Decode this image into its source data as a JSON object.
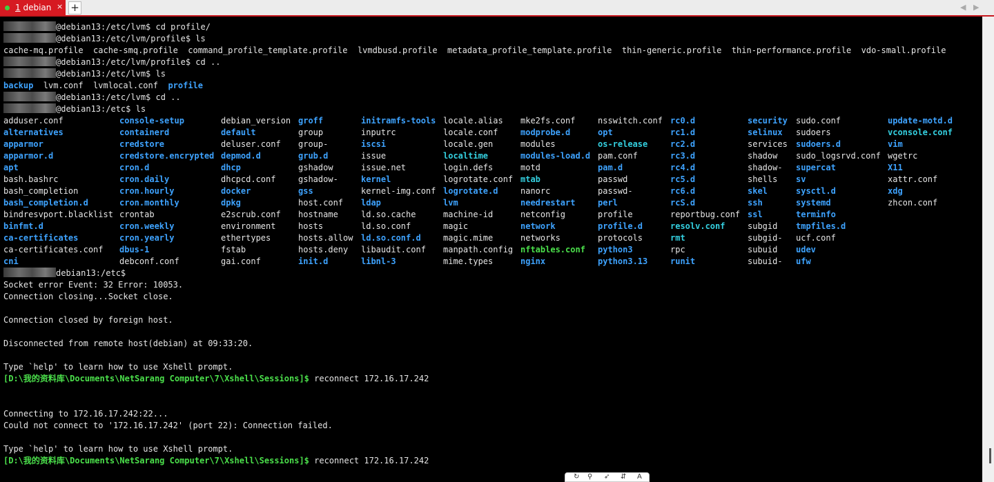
{
  "tab": {
    "number": "1",
    "title": "debian",
    "close_glyph": "×",
    "new_tab_glyph": "+",
    "status_color": "#3fd13f"
  },
  "nav": {
    "prev_glyph": "◀",
    "next_glyph": "▶"
  },
  "terminal": {
    "lines_before": [
      {
        "mask": true,
        "text": "@debian13:/etc/lvm$ cd profile/"
      },
      {
        "mask": true,
        "text": "@debian13:/etc/lvm/profile$ ls"
      },
      {
        "mask": false,
        "text": "cache-mq.profile  cache-smq.profile  command_profile_template.profile  lvmdbusd.profile  metadata_profile_template.profile  thin-generic.profile  thin-performance.profile  vdo-small.profile"
      },
      {
        "mask": true,
        "text": "@debian13:/etc/lvm/profile$ cd .."
      },
      {
        "mask": true,
        "text": "@debian13:/etc/lvm$ ls"
      },
      {
        "mask": false,
        "segments": [
          {
            "text": "backup",
            "cls": "dir"
          },
          {
            "text": "  lvm.conf  lvmlocal.conf  ",
            "cls": ""
          },
          {
            "text": "profile",
            "cls": "dir"
          }
        ]
      },
      {
        "mask": true,
        "text": "@debian13:/etc/lvm$ cd .."
      },
      {
        "mask": true,
        "text": "@debian13:/etc$ ls"
      }
    ],
    "ls_columns": [
      [
        [
          "adduser.conf",
          ""
        ],
        [
          "alternatives",
          "dir"
        ],
        [
          "apparmor",
          "dir"
        ],
        [
          "apparmor.d",
          "dir"
        ],
        [
          "apt",
          "dir"
        ],
        [
          "bash.bashrc",
          ""
        ],
        [
          "bash_completion",
          ""
        ],
        [
          "bash_completion.d",
          "dir"
        ],
        [
          "bindresvport.blacklist",
          ""
        ],
        [
          "binfmt.d",
          "dir"
        ],
        [
          "ca-certificates",
          "dir"
        ],
        [
          "ca-certificates.conf",
          ""
        ],
        [
          "cni",
          "dir"
        ]
      ],
      [
        [
          "console-setup",
          "dir"
        ],
        [
          "containerd",
          "dir"
        ],
        [
          "credstore",
          "dir"
        ],
        [
          "credstore.encrypted",
          "dir"
        ],
        [
          "cron.d",
          "dir"
        ],
        [
          "cron.daily",
          "dir"
        ],
        [
          "cron.hourly",
          "dir"
        ],
        [
          "cron.monthly",
          "dir"
        ],
        [
          "crontab",
          ""
        ],
        [
          "cron.weekly",
          "dir"
        ],
        [
          "cron.yearly",
          "dir"
        ],
        [
          "dbus-1",
          "dir"
        ],
        [
          "debconf.conf",
          ""
        ]
      ],
      [
        [
          "debian_version",
          ""
        ],
        [
          "default",
          "dir"
        ],
        [
          "deluser.conf",
          ""
        ],
        [
          "depmod.d",
          "dir"
        ],
        [
          "dhcp",
          "dir"
        ],
        [
          "dhcpcd.conf",
          ""
        ],
        [
          "docker",
          "dir"
        ],
        [
          "dpkg",
          "dir"
        ],
        [
          "e2scrub.conf",
          ""
        ],
        [
          "environment",
          ""
        ],
        [
          "ethertypes",
          ""
        ],
        [
          "fstab",
          ""
        ],
        [
          "gai.conf",
          ""
        ]
      ],
      [
        [
          "groff",
          "dir"
        ],
        [
          "group",
          ""
        ],
        [
          "group-",
          ""
        ],
        [
          "grub.d",
          "dir"
        ],
        [
          "gshadow",
          ""
        ],
        [
          "gshadow-",
          ""
        ],
        [
          "gss",
          "dir"
        ],
        [
          "host.conf",
          ""
        ],
        [
          "hostname",
          ""
        ],
        [
          "hosts",
          ""
        ],
        [
          "hosts.allow",
          ""
        ],
        [
          "hosts.deny",
          ""
        ],
        [
          "init.d",
          "dir"
        ]
      ],
      [
        [
          "initramfs-tools",
          "dir"
        ],
        [
          "inputrc",
          ""
        ],
        [
          "iscsi",
          "dir"
        ],
        [
          "issue",
          ""
        ],
        [
          "issue.net",
          ""
        ],
        [
          "kernel",
          "dir"
        ],
        [
          "kernel-img.conf",
          ""
        ],
        [
          "ldap",
          "dir"
        ],
        [
          "ld.so.cache",
          ""
        ],
        [
          "ld.so.conf",
          ""
        ],
        [
          "ld.so.conf.d",
          "dir"
        ],
        [
          "libaudit.conf",
          ""
        ],
        [
          "libnl-3",
          "dir"
        ]
      ],
      [
        [
          "locale.alias",
          ""
        ],
        [
          "locale.conf",
          ""
        ],
        [
          "locale.gen",
          ""
        ],
        [
          "localtime",
          "link"
        ],
        [
          "login.defs",
          ""
        ],
        [
          "logrotate.conf",
          ""
        ],
        [
          "logrotate.d",
          "dir"
        ],
        [
          "lvm",
          "dir"
        ],
        [
          "machine-id",
          ""
        ],
        [
          "magic",
          ""
        ],
        [
          "magic.mime",
          ""
        ],
        [
          "manpath.config",
          ""
        ],
        [
          "mime.types",
          ""
        ]
      ],
      [
        [
          "mke2fs.conf",
          ""
        ],
        [
          "modprobe.d",
          "dir"
        ],
        [
          "modules",
          ""
        ],
        [
          "modules-load.d",
          "dir"
        ],
        [
          "motd",
          ""
        ],
        [
          "mtab",
          "link"
        ],
        [
          "nanorc",
          ""
        ],
        [
          "needrestart",
          "dir"
        ],
        [
          "netconfig",
          ""
        ],
        [
          "network",
          "dir"
        ],
        [
          "networks",
          ""
        ],
        [
          "nftables.conf",
          "exe"
        ],
        [
          "nginx",
          "dir"
        ]
      ],
      [
        [
          "nsswitch.conf",
          ""
        ],
        [
          "opt",
          "dir"
        ],
        [
          "os-release",
          "link"
        ],
        [
          "pam.conf",
          ""
        ],
        [
          "pam.d",
          "dir"
        ],
        [
          "passwd",
          ""
        ],
        [
          "passwd-",
          ""
        ],
        [
          "perl",
          "dir"
        ],
        [
          "profile",
          ""
        ],
        [
          "profile.d",
          "dir"
        ],
        [
          "protocols",
          ""
        ],
        [
          "python3",
          "dir"
        ],
        [
          "python3.13",
          "dir"
        ]
      ],
      [
        [
          "rc0.d",
          "dir"
        ],
        [
          "rc1.d",
          "dir"
        ],
        [
          "rc2.d",
          "dir"
        ],
        [
          "rc3.d",
          "dir"
        ],
        [
          "rc4.d",
          "dir"
        ],
        [
          "rc5.d",
          "dir"
        ],
        [
          "rc6.d",
          "dir"
        ],
        [
          "rcS.d",
          "dir"
        ],
        [
          "reportbug.conf",
          ""
        ],
        [
          "resolv.conf",
          "link"
        ],
        [
          "rmt",
          "link"
        ],
        [
          "rpc",
          ""
        ],
        [
          "runit",
          "dir"
        ]
      ],
      [
        [
          "security",
          "dir"
        ],
        [
          "selinux",
          "dir"
        ],
        [
          "services",
          ""
        ],
        [
          "shadow",
          ""
        ],
        [
          "shadow-",
          ""
        ],
        [
          "shells",
          ""
        ],
        [
          "skel",
          "dir"
        ],
        [
          "ssh",
          "dir"
        ],
        [
          "ssl",
          "dir"
        ],
        [
          "subgid",
          ""
        ],
        [
          "subgid-",
          ""
        ],
        [
          "subuid",
          ""
        ],
        [
          "subuid-",
          ""
        ]
      ],
      [
        [
          "sudo.conf",
          ""
        ],
        [
          "sudoers",
          ""
        ],
        [
          "sudoers.d",
          "dir"
        ],
        [
          "sudo_logsrvd.conf",
          ""
        ],
        [
          "supercat",
          "dir"
        ],
        [
          "sv",
          "dir"
        ],
        [
          "sysctl.d",
          "dir"
        ],
        [
          "systemd",
          "dir"
        ],
        [
          "terminfo",
          "dir"
        ],
        [
          "tmpfiles.d",
          "dir"
        ],
        [
          "ucf.conf",
          ""
        ],
        [
          "udev",
          "dir"
        ],
        [
          "ufw",
          "dir"
        ]
      ],
      [
        [
          "update-motd.d",
          "dir"
        ],
        [
          "vconsole.conf",
          "link"
        ],
        [
          "vim",
          "dir"
        ],
        [
          "wgetrc",
          ""
        ],
        [
          "X11",
          "dir"
        ],
        [
          "xattr.conf",
          ""
        ],
        [
          "xdg",
          "dir"
        ],
        [
          "zhcon.conf",
          ""
        ]
      ]
    ],
    "lines_after": [
      {
        "mask": true,
        "text": "debian13:/etc$"
      },
      {
        "text": "Socket error Event: 32 Error: 10053."
      },
      {
        "text": "Connection closing...Socket close."
      },
      {
        "text": ""
      },
      {
        "text": "Connection closed by foreign host."
      },
      {
        "text": ""
      },
      {
        "text": "Disconnected from remote host(debian) at 09:33:20."
      },
      {
        "text": ""
      },
      {
        "text": "Type `help' to learn how to use Xshell prompt."
      },
      {
        "prompt": "[D:\\我的资料库\\Documents\\NetSarang Computer\\7\\Xshell\\Sessions]$",
        "text": " reconnect 172.16.17.242"
      },
      {
        "text": ""
      },
      {
        "text": ""
      },
      {
        "text": "Connecting to 172.16.17.242:22..."
      },
      {
        "text": "Could not connect to '172.16.17.242' (port 22): Connection failed."
      },
      {
        "text": ""
      },
      {
        "text": "Type `help' to learn how to use Xshell prompt."
      },
      {
        "prompt": "[D:\\我的资料库\\Documents\\NetSarang Computer\\7\\Xshell\\Sessions]$",
        "text": " reconnect 172.16.17.242"
      }
    ]
  },
  "colors": {
    "background": "#000000",
    "text": "#e6e6e6",
    "directory": "#3ea3ff",
    "link": "#34d0e0",
    "executable": "#4be04b",
    "tab_accent": "#d61a22"
  }
}
